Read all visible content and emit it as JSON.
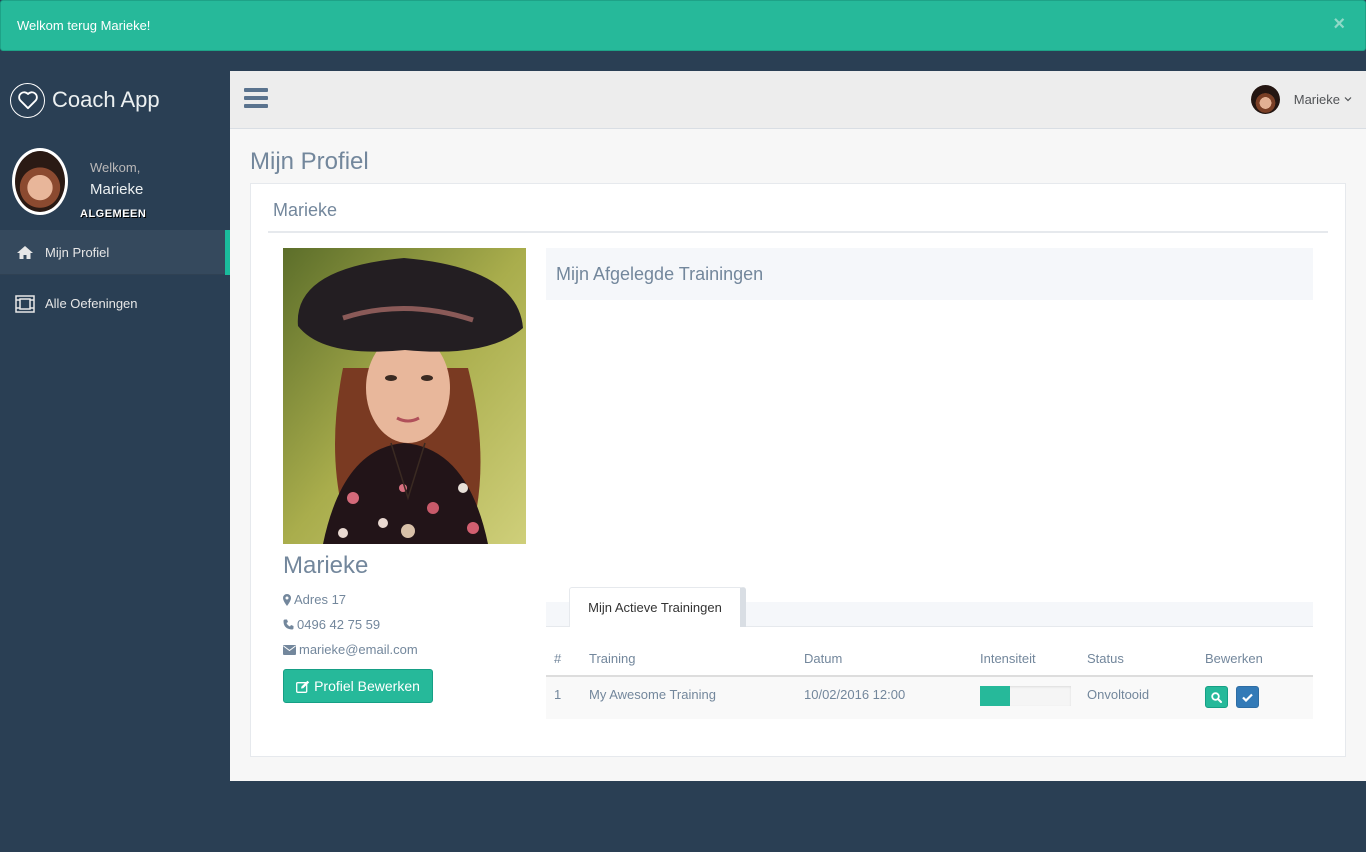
{
  "alert": {
    "message": "Welkom terug Marieke!",
    "close": "×"
  },
  "sidebar": {
    "brand": "Coach App",
    "welcome": "Welkom,",
    "user_name": "Marieke",
    "section": "ALGEMEEN",
    "items": [
      {
        "label": "Mijn Profiel",
        "icon": "home-icon",
        "active": true
      },
      {
        "label": "Alle Oefeningen",
        "icon": "exercises-icon",
        "active": false
      }
    ]
  },
  "topnav": {
    "user_name": "Marieke",
    "caret": "⌄"
  },
  "page": {
    "title": "Mijn Profiel",
    "panel_title": "Marieke"
  },
  "profile": {
    "name": "Marieke",
    "address": "Adres 17",
    "phone": "0496 42 75 59",
    "email": "marieke@email.com",
    "edit_label": "Profiel Bewerken"
  },
  "trainings": {
    "completed_title": "Mijn Afgelegde Trainingen",
    "active_tab": "Mijn Actieve Trainingen",
    "columns": [
      "#",
      "Training",
      "Datum",
      "Intensiteit",
      "Status",
      "Bewerken"
    ],
    "rows": [
      {
        "num": "1",
        "training": "My Awesome Training",
        "date": "10/02/2016 12:00",
        "intensity": 0.33,
        "status": "Onvoltooid"
      }
    ]
  },
  "colors": {
    "accent": "#26b99a",
    "sidebar": "#2a3f54",
    "primary": "#337ab7"
  }
}
